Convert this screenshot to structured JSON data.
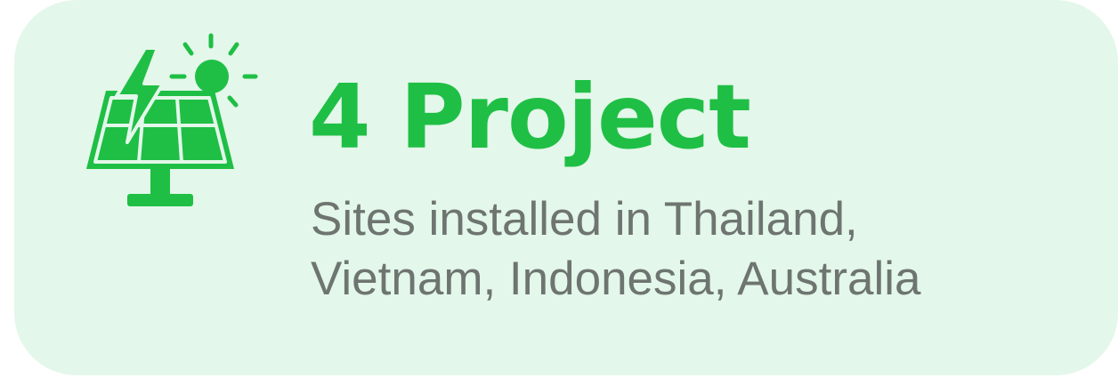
{
  "card": {
    "title": "4 Project",
    "description_lines": [
      "Sites installed in Thailand,",
      "Vietnam, Indonesia, Australia"
    ]
  },
  "icon": {
    "name": "solar-panel-lightning-sun-icon"
  },
  "colors": {
    "accent_green": "#1fbf45",
    "card_background": "#e3f7ea",
    "text_gray": "#6e7571"
  }
}
